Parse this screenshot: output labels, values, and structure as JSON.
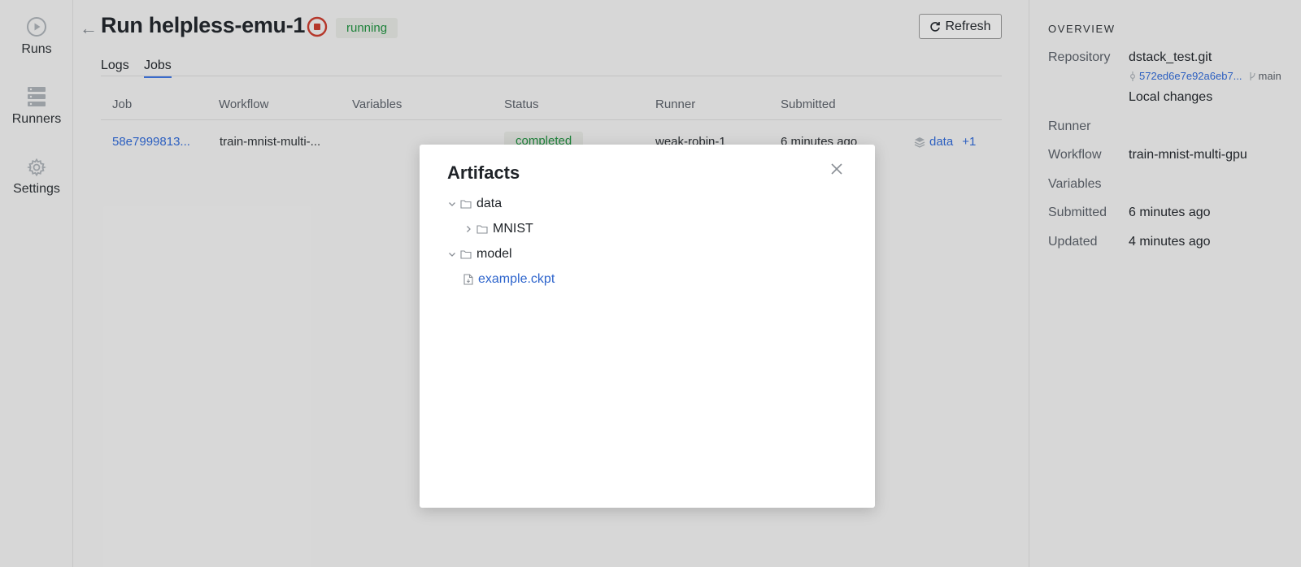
{
  "nav": {
    "items": [
      {
        "label": "Runs",
        "icon": "play-circle-icon"
      },
      {
        "label": "Runners",
        "icon": "server-icon"
      },
      {
        "label": "Settings",
        "icon": "gear-icon"
      }
    ]
  },
  "header": {
    "back": "←",
    "title": "Run helpless-emu-1",
    "status": "running",
    "refresh_label": "Refresh"
  },
  "tabs": [
    {
      "label": "Logs",
      "active": false
    },
    {
      "label": "Jobs",
      "active": true
    }
  ],
  "jobs_table": {
    "columns": [
      "Job",
      "Workflow",
      "Variables",
      "Status",
      "Runner",
      "Submitted"
    ],
    "rows": [
      {
        "job": "58e7999813...",
        "workflow": "train-mnist-multi-...",
        "variables": "",
        "status": "completed",
        "runner": "weak-robin-1",
        "submitted": "6 minutes ago",
        "artifacts_label": "data",
        "artifacts_more": "+1"
      }
    ]
  },
  "overview": {
    "title": "OVERVIEW",
    "repository_label": "Repository",
    "repository": "dstack_test.git",
    "commit": "572ed6e7e92a6eb7...",
    "branch": "main",
    "local_changes": "Local changes",
    "runner_label": "Runner",
    "runner": "",
    "workflow_label": "Workflow",
    "workflow": "train-mnist-multi-gpu",
    "variables_label": "Variables",
    "variables": "",
    "submitted_label": "Submitted",
    "submitted": "6 minutes ago",
    "updated_label": "Updated",
    "updated": "4 minutes ago"
  },
  "modal": {
    "title": "Artifacts",
    "tree": {
      "data": "data",
      "mnist": "MNIST",
      "model": "model",
      "checkpoint": "example.ckpt"
    }
  },
  "colors": {
    "link": "#2d64cc",
    "success": "#1f8a3d",
    "stop": "#c0392b",
    "tab_active": "#3b6fd8"
  }
}
